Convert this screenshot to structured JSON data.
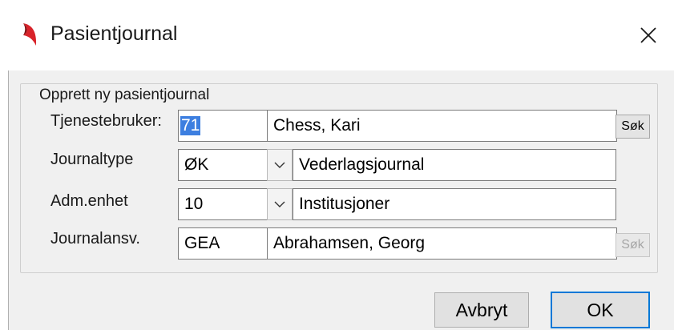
{
  "window": {
    "title": "Pasientjournal",
    "logo_icon": "app-logo-icon",
    "close_glyph": "✕"
  },
  "group": {
    "title": "Opprett ny pasientjournal"
  },
  "fields": {
    "tjenestebruker": {
      "label": "Tjenestebruker:",
      "code": "71",
      "name": "Chess, Kari",
      "search_label": "Søk"
    },
    "journaltype": {
      "label": "Journaltype",
      "code": "ØK",
      "name": "Vederlagsjournal"
    },
    "adm_enhet": {
      "label": "Adm.enhet",
      "code": "10",
      "name": "Institusjoner"
    },
    "journalansv": {
      "label": "Journalansv.",
      "code": "GEA",
      "name": "Abrahamsen, Georg",
      "search_label": "Søk"
    }
  },
  "buttons": {
    "cancel": "Avbryt",
    "ok": "OK"
  },
  "colors": {
    "selection": "#3d7fe0",
    "logo_red": "#d8232a",
    "default_button_border": "#0078d7",
    "dialog_background": "#f0f0f0"
  }
}
